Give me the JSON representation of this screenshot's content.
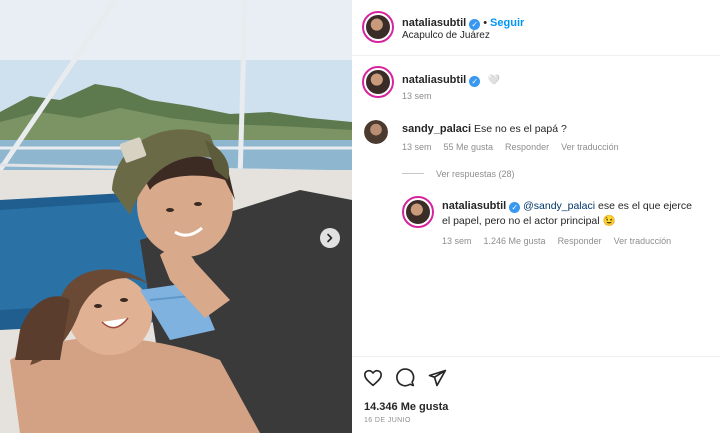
{
  "post": {
    "author": "nataliasubtil",
    "follow_label": "Seguir",
    "location": "Acapulco de Juárez",
    "separator": "•",
    "verified_glyph": "✓"
  },
  "caption": {
    "author": "nataliasubtil",
    "emoji": "🤍",
    "time": "13 sem"
  },
  "comment": {
    "author": "sandy_palaci",
    "text": "Ese no es el papá ?",
    "time": "13 sem",
    "likes": "55 Me gusta",
    "reply_label": "Responder",
    "translate_label": "Ver traducción",
    "view_replies": "Ver respuestas (28)"
  },
  "reply": {
    "author": "nataliasubtil",
    "mention": "@sandy_palaci",
    "text_1": " ese es el que ejerce",
    "text_2": "el papel, pero no el actor principal 😉",
    "time": "13 sem",
    "likes": "1.246 Me gusta",
    "reply_label": "Responder",
    "translate_label": "Ver traducción"
  },
  "footer": {
    "likes": "14.346 Me gusta",
    "date": "16 DE JUNIO"
  },
  "icons": {
    "like": "heart-icon",
    "comment": "comment-icon",
    "share": "share-icon",
    "next": "chevron-right-icon"
  },
  "colors": {
    "link_blue": "#0095f6",
    "verified_blue": "#3897f0",
    "meta_gray": "#8e8e8e"
  }
}
